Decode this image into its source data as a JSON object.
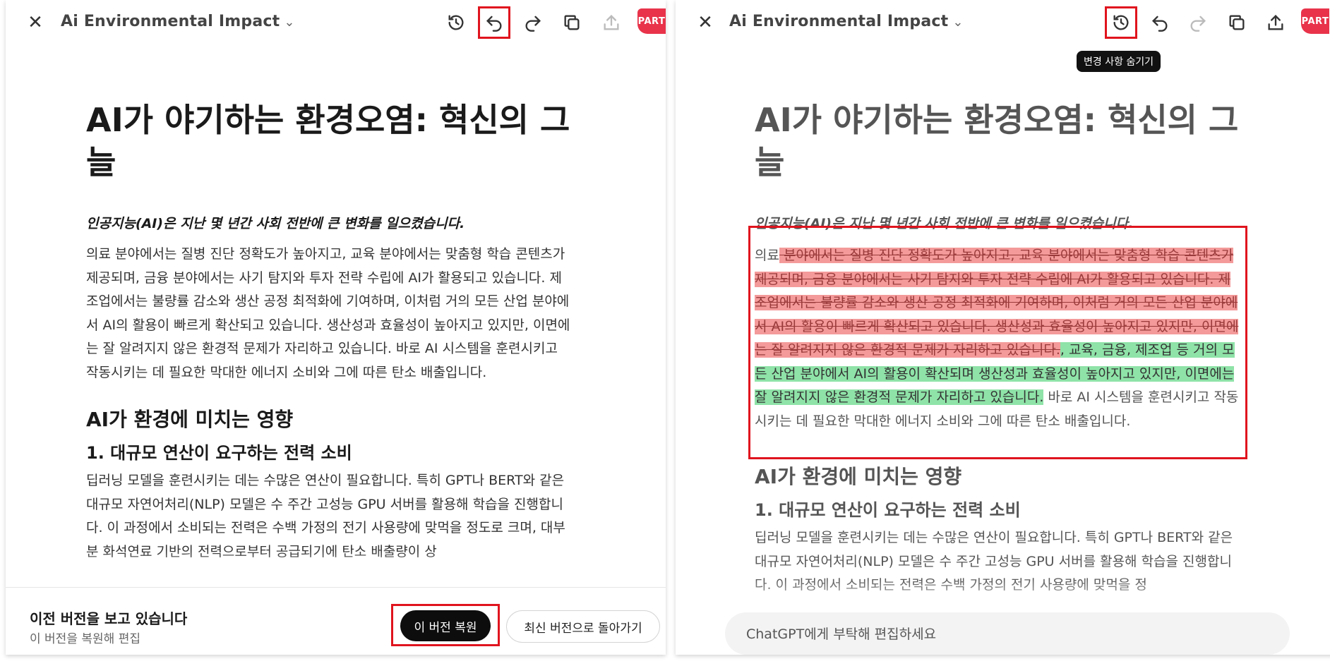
{
  "left": {
    "title": "Ai Environmental Impact",
    "badge": "PART",
    "doc": {
      "h1": "AI가 야기하는 환경오염: 혁신의 그늘",
      "lead": "인공지능(AI)은 지난 몇 년간 사회 전반에 큰 변화를 일으켰습니다.",
      "para": "의료 분야에서는 질병 진단 정확도가 높아지고, 교육 분야에서는 맞춤형 학습 콘텐츠가 제공되며, 금융 분야에서는 사기 탐지와 투자 전략 수립에 AI가 활용되고 있습니다. 제조업에서는 불량률 감소와 생산 공정 최적화에 기여하며, 이처럼 거의 모든 산업 분야에서 AI의 활용이 빠르게 확산되고 있습니다. 생산성과 효율성이 높아지고 있지만, 이면에는 잘 알려지지 않은 환경적 문제가 자리하고 있습니다. 바로 AI 시스템을 훈련시키고 작동시키는 데 필요한 막대한 에너지 소비와 그에 따른 탄소 배출입니다.",
      "h2": "AI가 환경에 미치는 영향",
      "h3": "1. 대규모 연산이 요구하는 전력 소비",
      "para2": "딥러닝 모델을 훈련시키는 데는 수많은 연산이 필요합니다. 특히 GPT나 BERT와 같은 대규모 자연어처리(NLP) 모델은 수 주간 고성능 GPU 서버를 활용해 학습을 진행합니다. 이 과정에서 소비되는 전력은 수백 가정의 전기 사용량에 맞먹을 정도로 크며, 대부분 화석연료 기반의 전력으로부터 공급되기에 탄소 배출량이 상"
    },
    "bottom": {
      "title": "이전 버전을 보고 있습니다",
      "subtitle": "이 버전을 복원해 편집",
      "restore_button": "이 버전 복원",
      "latest_button": "최신 버전으로 돌아가기"
    }
  },
  "right": {
    "title": "Ai Environmental Impact",
    "badge": "PART",
    "tooltip": "변경 사항 숨기기",
    "doc": {
      "h1": "AI가 야기하는 환경오염: 혁신의 그늘",
      "lead": "인공지능(AI)은 지난 몇 년간 사회 전반에 큰 변화를 일으켰습니다.",
      "para_prefix": "의료",
      "para_deleted": " 분야에서는 질병 진단 정확도가 높아지고, 교육 분야에서는 맞춤형 학습 콘텐츠가 제공되며, 금융 분야에서는 사기 탐지와 투자 전략 수립에 AI가 활용되고 있습니다. 제조업에서는 불량률 감소와 생산 공정 최적화에 기여하며, 이처럼 거의 모든 산업 분야에서 AI의 활용이 빠르게 확산되고 있습니다. 생산성과 효율성이 높아지고 있지만, 이면에는 잘 알려지지 않은 환경적 문제가 자리하고 있습니다.",
      "para_inserted": ", 교육, 금융, 제조업 등 거의 모든 산업 분야에서 AI의 활용이 확산되며 생산성과 효율성이 높아지고 있지만, 이면에는 잘 알려지지 않은 환경적 문제가 자리하고 있습니다.",
      "para_suffix": " 바로 AI 시스템을 훈련시키고 작동시키는 데 필요한 막대한 에너지 소비와 그에 따른 탄소 배출입니다.",
      "h2": "AI가 환경에 미치는 영향",
      "h3": "1. 대규모 연산이 요구하는 전력 소비",
      "para2": "딥러닝 모델을 훈련시키는 데는 수많은 연산이 필요합니다. 특히 GPT나 BERT와 같은 대규모 자연어처리(NLP) 모델은 수 주간 고성능 GPU 서버를 활용해 학습을 진행합니다. 이 과정에서 소비되는 전력은 수백 가정의 전기 사용량에 맞먹을 정"
    },
    "composer": {
      "placeholder": "ChatGPT에게 부탁해 편집하세요"
    }
  }
}
